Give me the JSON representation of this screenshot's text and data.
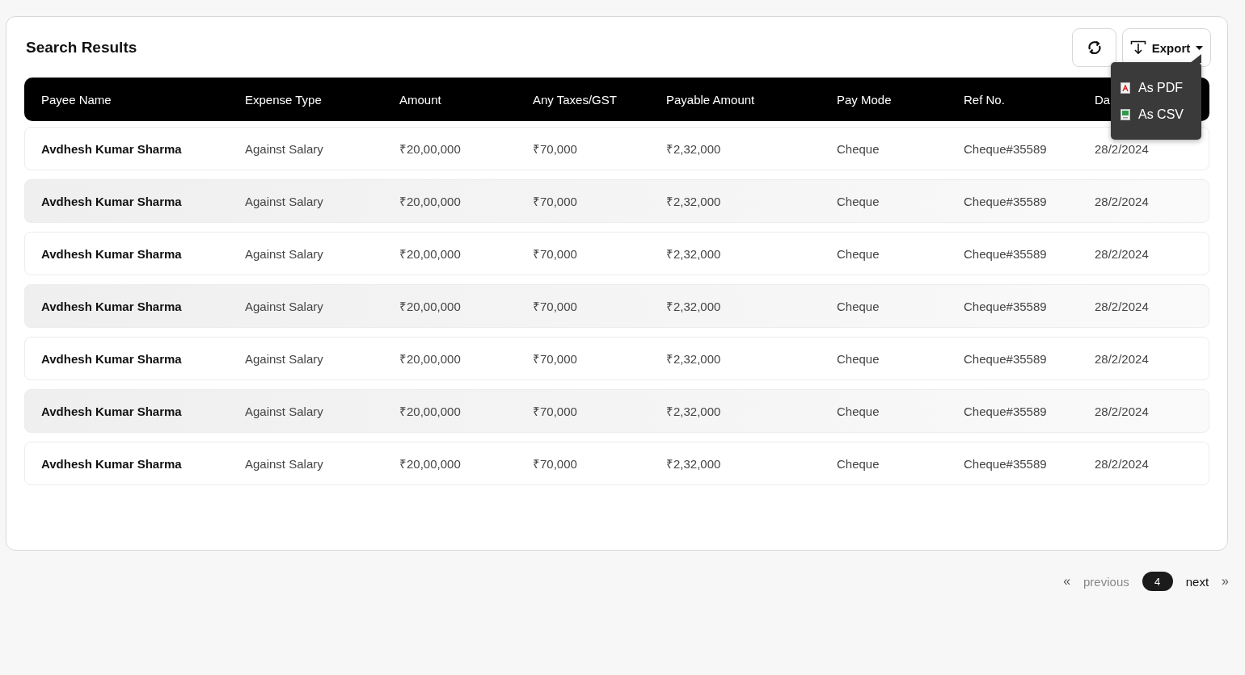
{
  "title": "Search Results",
  "toolbar": {
    "export": {
      "label": "Export",
      "expanded": true,
      "menu": [
        {
          "kind": "pdf",
          "label": "As PDF"
        },
        {
          "kind": "csv",
          "label": "As CSV"
        }
      ]
    }
  },
  "table": {
    "columns": [
      "Payee Name",
      "Expense Type",
      "Amount",
      "Any Taxes/GST",
      "Payable Amount",
      "Pay Mode",
      "Ref No.",
      "Da"
    ],
    "rows": [
      [
        "Avdhesh Kumar Sharma",
        "Against Salary",
        "₹20,00,000",
        "₹70,000",
        "₹2,32,000",
        "Cheque",
        "Cheque#35589",
        "28/2/2024"
      ],
      [
        "Avdhesh Kumar Sharma",
        "Against Salary",
        "₹20,00,000",
        "₹70,000",
        "₹2,32,000",
        "Cheque",
        "Cheque#35589",
        "28/2/2024"
      ],
      [
        "Avdhesh Kumar Sharma",
        "Against Salary",
        "₹20,00,000",
        "₹70,000",
        "₹2,32,000",
        "Cheque",
        "Cheque#35589",
        "28/2/2024"
      ],
      [
        "Avdhesh Kumar Sharma",
        "Against Salary",
        "₹20,00,000",
        "₹70,000",
        "₹2,32,000",
        "Cheque",
        "Cheque#35589",
        "28/2/2024"
      ],
      [
        "Avdhesh Kumar Sharma",
        "Against Salary",
        "₹20,00,000",
        "₹70,000",
        "₹2,32,000",
        "Cheque",
        "Cheque#35589",
        "28/2/2024"
      ],
      [
        "Avdhesh Kumar Sharma",
        "Against Salary",
        "₹20,00,000",
        "₹70,000",
        "₹2,32,000",
        "Cheque",
        "Cheque#35589",
        "28/2/2024"
      ],
      [
        "Avdhesh Kumar Sharma",
        "Against Salary",
        "₹20,00,000",
        "₹70,000",
        "₹2,32,000",
        "Cheque",
        "Cheque#35589",
        "28/2/2024"
      ]
    ]
  },
  "pagination": {
    "first": "«",
    "previous": "previous",
    "pages": [
      {
        "label": "4",
        "selected": true
      }
    ],
    "next": "next",
    "last": "»"
  }
}
